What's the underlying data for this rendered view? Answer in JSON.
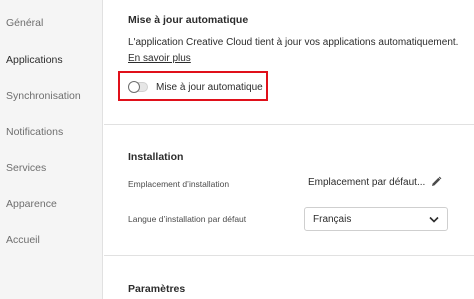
{
  "sidebar": {
    "items": [
      {
        "label": "Général",
        "active": false
      },
      {
        "label": "Applications",
        "active": true
      },
      {
        "label": "Synchronisation",
        "active": false
      },
      {
        "label": "Notifications",
        "active": false
      },
      {
        "label": "Services",
        "active": false
      },
      {
        "label": "Apparence",
        "active": false
      },
      {
        "label": "Accueil",
        "active": false
      }
    ]
  },
  "auto_update": {
    "title": "Mise à jour automatique",
    "description": "L'application Creative Cloud tient à jour vos applications automatiquement.",
    "learn_more": "En savoir plus",
    "toggle_label": "Mise à jour automatique",
    "toggle_on": false,
    "highlight_color": "#e0101a"
  },
  "installation": {
    "title": "Installation",
    "location_label": "Emplacement d’installation",
    "location_value": "Emplacement par défaut...",
    "language_label": "Langue d’installation par défaut",
    "language_value": "Français"
  },
  "parameters": {
    "title": "Paramètres"
  }
}
